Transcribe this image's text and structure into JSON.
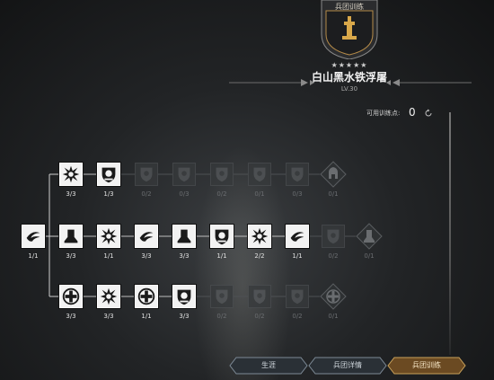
{
  "header": {
    "crest_title": "兵团训练",
    "stars": "★★★★★",
    "unit_name": "白山黑水铁浮屠",
    "unit_level": "LV.30"
  },
  "points": {
    "label": "可用训练点:",
    "value": "0"
  },
  "tree": {
    "root": {
      "label": "1/1",
      "icon": "swirl-icon",
      "state": "active"
    },
    "row_top": [
      {
        "label": "3/3",
        "icon": "burst-icon",
        "state": "active"
      },
      {
        "label": "1/3",
        "icon": "shield-emblem-icon",
        "state": "active"
      },
      {
        "label": "0/2",
        "icon": "shield-icon",
        "state": "locked"
      },
      {
        "label": "0/3",
        "icon": "shield-icon",
        "state": "locked"
      },
      {
        "label": "0/2",
        "icon": "shield-icon",
        "state": "locked"
      },
      {
        "label": "0/1",
        "icon": "shield-icon",
        "state": "locked"
      },
      {
        "label": "0/3",
        "icon": "shield-icon",
        "state": "locked"
      },
      {
        "label": "0/1",
        "icon": "helmet-icon",
        "state": "locked-diamond"
      }
    ],
    "row_mid": [
      {
        "label": "3/3",
        "icon": "bell-icon",
        "state": "active"
      },
      {
        "label": "1/1",
        "icon": "burst-icon",
        "state": "active"
      },
      {
        "label": "3/3",
        "icon": "swirl-icon",
        "state": "active"
      },
      {
        "label": "3/3",
        "icon": "bell-icon",
        "state": "active"
      },
      {
        "label": "1/1",
        "icon": "shield-emblem-icon",
        "state": "active"
      },
      {
        "label": "2/2",
        "icon": "burst-icon",
        "state": "active"
      },
      {
        "label": "1/1",
        "icon": "swirl-icon",
        "state": "active"
      },
      {
        "label": "0/2",
        "icon": "shield-icon",
        "state": "locked"
      },
      {
        "label": "0/1",
        "icon": "bell-icon",
        "state": "locked-diamond"
      }
    ],
    "row_bot": [
      {
        "label": "3/3",
        "icon": "cross-icon",
        "state": "active"
      },
      {
        "label": "3/3",
        "icon": "burst-icon",
        "state": "active"
      },
      {
        "label": "1/1",
        "icon": "cross-icon",
        "state": "active"
      },
      {
        "label": "3/3",
        "icon": "shield-emblem-icon",
        "state": "active"
      },
      {
        "label": "0/2",
        "icon": "shield-icon",
        "state": "locked"
      },
      {
        "label": "0/2",
        "icon": "shield-icon",
        "state": "locked"
      },
      {
        "label": "0/2",
        "icon": "shield-icon",
        "state": "locked"
      },
      {
        "label": "0/1",
        "icon": "cross-icon",
        "state": "locked-diamond"
      }
    ]
  },
  "tabs": [
    {
      "label": "生涯",
      "selected": false
    },
    {
      "label": "兵团详情",
      "selected": false
    },
    {
      "label": "兵团训练",
      "selected": true
    }
  ],
  "colors": {
    "accent": "#c9a15a",
    "tab_selected": "#6b4a22"
  }
}
